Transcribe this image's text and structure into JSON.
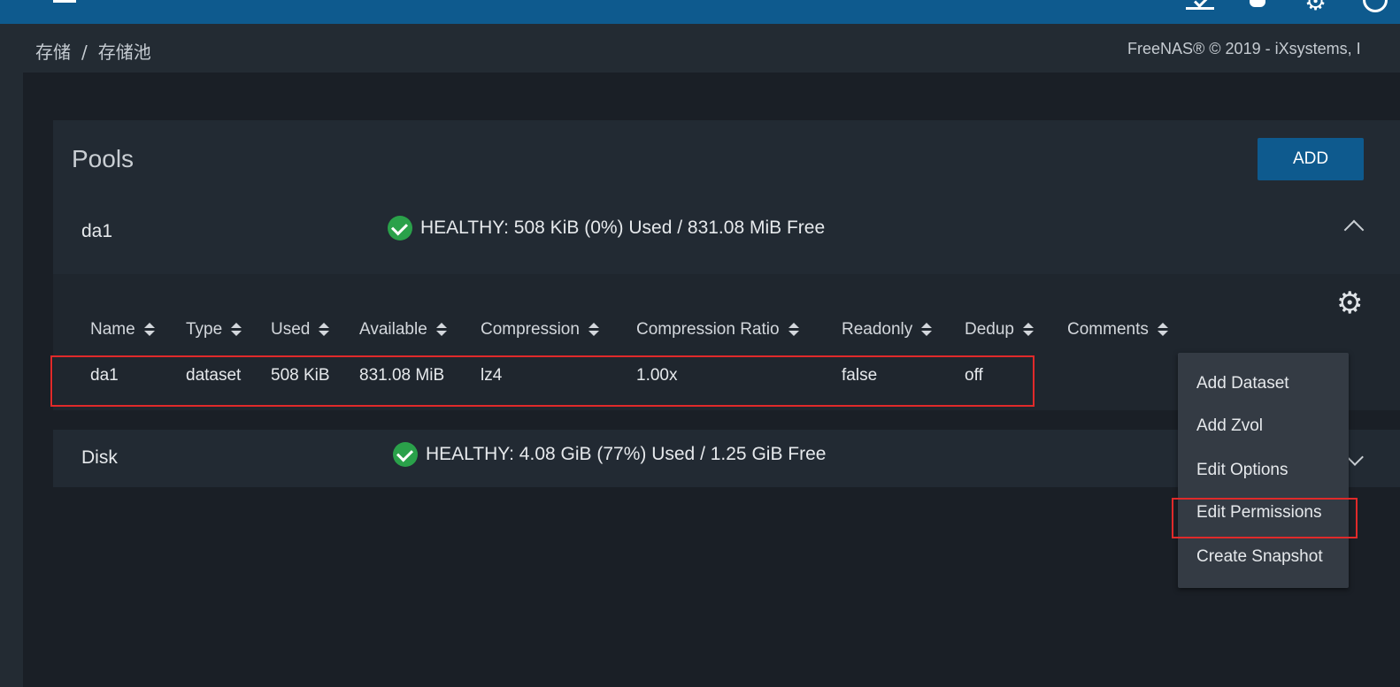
{
  "breadcrumb": {
    "root": "存储",
    "separator": "/",
    "current": "存储池"
  },
  "copyright": "FreeNAS® © 2019 - iXsystems, I",
  "pools": {
    "title": "Pools",
    "add_label": "ADD",
    "items": [
      {
        "name": "da1",
        "status": "HEALTHY: 508 KiB (0%) Used / 831.08 MiB Free",
        "expanded": true
      },
      {
        "name": "Disk",
        "status": "HEALTHY: 4.08 GiB (77%) Used / 1.25 GiB Free",
        "expanded": false
      }
    ]
  },
  "table": {
    "headers": [
      "Name",
      "Type",
      "Used",
      "Available",
      "Compression",
      "Compression Ratio",
      "Readonly",
      "Dedup",
      "Comments"
    ],
    "row": [
      "da1",
      "dataset",
      "508 KiB",
      "831.08 MiB",
      "lz4",
      "1.00x",
      "false",
      "off",
      ""
    ]
  },
  "menu": {
    "items": [
      "Add Dataset",
      "Add Zvol",
      "Edit Options",
      "Edit Permissions",
      "Create Snapshot"
    ]
  },
  "colors": {
    "accent": "#0e5a8e",
    "healthy": "#2aa14a",
    "highlight": "#e02a2a"
  }
}
